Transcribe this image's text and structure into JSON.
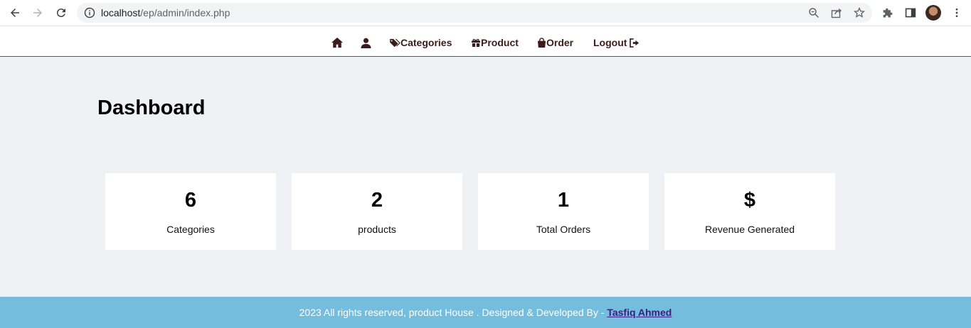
{
  "browser": {
    "url_host": "localhost",
    "url_path": "/ep/admin/index.php"
  },
  "nav": {
    "categories_label": "Categories",
    "product_label": "Product",
    "order_label": "Order",
    "logout_label": "Logout"
  },
  "page": {
    "title": "Dashboard"
  },
  "stats": [
    {
      "value": "6",
      "label": "Categories"
    },
    {
      "value": "2",
      "label": "products"
    },
    {
      "value": "1",
      "label": "Total Orders"
    },
    {
      "value": "$",
      "label": "Revenue Generated"
    }
  ],
  "footer": {
    "text": "2023 All rights reserved, product House . Designed & Developed By - ",
    "author": "Tasfiq Ahmed"
  },
  "colors": {
    "nav_text": "#3b1c1c",
    "footer_bg": "#74bddc",
    "author_link": "#3a1e82",
    "page_bg": "#f0f1f4"
  }
}
